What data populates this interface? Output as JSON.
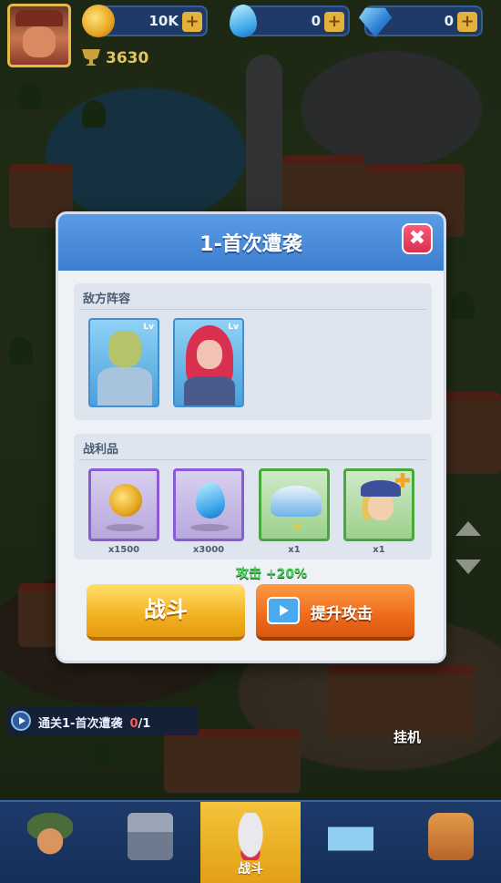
{
  "top_bar": {
    "coins": "10K",
    "drops": "0",
    "gems": "0",
    "trophies": "3630",
    "plus": "+"
  },
  "dialog": {
    "title": "1-首次遭袭",
    "close": "✖",
    "enemy_section_label": "敌方阵容",
    "loot_section_label": "战利品",
    "rewards": [
      {
        "name": "coin",
        "qty": "x1500"
      },
      {
        "name": "water-drop",
        "qty": "x3000"
      },
      {
        "name": "cap",
        "qty": "x1"
      },
      {
        "name": "hero",
        "qty": "x1"
      }
    ],
    "bonus_text": "攻击 +20%",
    "fight_button": "战斗",
    "boost_button": "提升攻击"
  },
  "quest": {
    "text": "通关1-首次遭袭",
    "progress_current": "0",
    "progress_total": "/1"
  },
  "afk_label": "挂机",
  "nav": {
    "active_label": "战斗"
  },
  "colors": {
    "accent_yellow": "#f2b122",
    "accent_orange": "#ee6b1c",
    "dialog_header_blue": "#3d7fcf",
    "nav_bg": "#1d3a6b"
  }
}
